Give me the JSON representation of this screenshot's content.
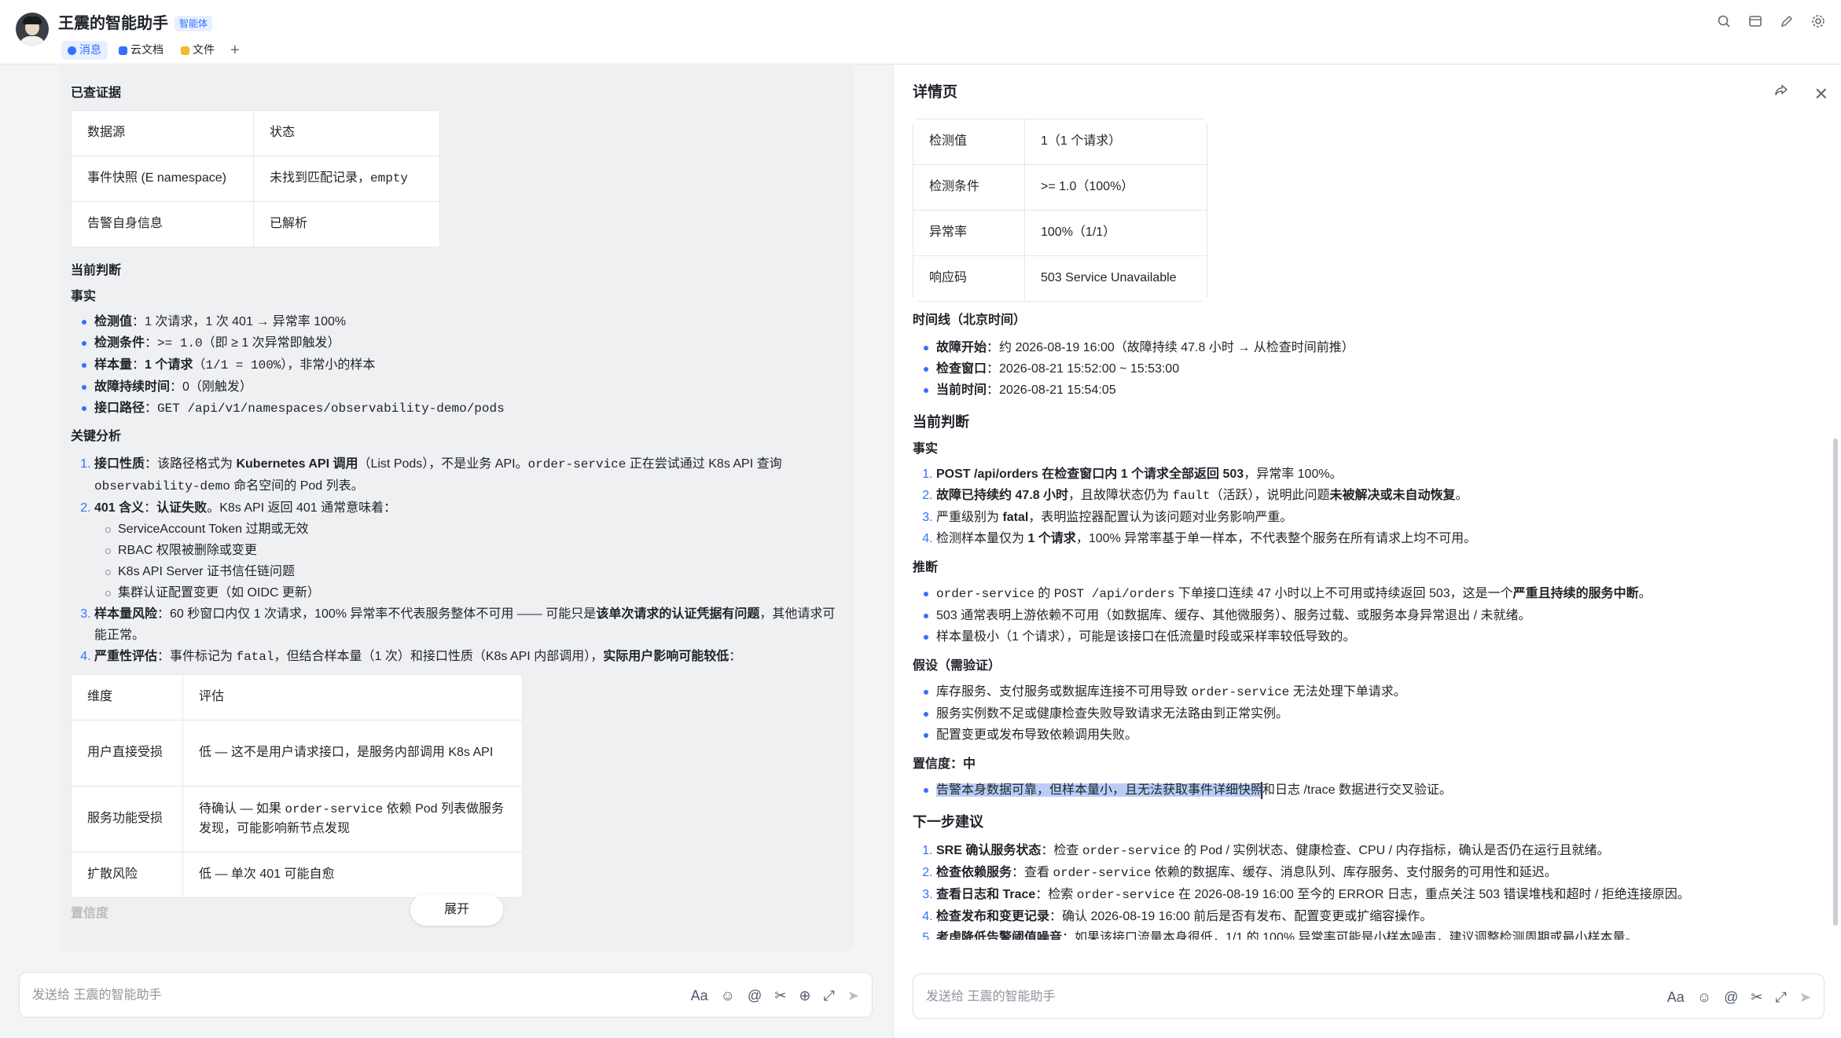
{
  "header": {
    "title": "王震的智能助手",
    "badge": "智能体",
    "tabs": [
      {
        "label": "消息",
        "icon": "chat-icon",
        "color": "#3370ff",
        "active": true
      },
      {
        "label": "云文档",
        "icon": "doc-icon",
        "color": "#3370ff",
        "active": false
      },
      {
        "label": "文件",
        "icon": "folder-icon",
        "color": "#f5b82e",
        "active": false
      }
    ],
    "add_tab": "+",
    "actions": [
      "search-icon",
      "window-icon",
      "edit-icon",
      "settings-icon"
    ]
  },
  "left": {
    "evidence_title": "已查证据",
    "evidence_table": {
      "headers": [
        "数据源",
        "状态"
      ],
      "rows": [
        [
          "事件快照 (E namespace)",
          "未找到匹配记录，",
          "empty"
        ],
        [
          "告警自身信息",
          "已解析"
        ]
      ]
    },
    "judgement_title": "当前判断",
    "facts_title": "事实",
    "facts": [
      {
        "label": "检测值",
        "text": "：1 次请求，1 次 401 → 异常率 100%"
      },
      {
        "label": "检测条件",
        "pre": "：",
        "code": ">= 1.0",
        "text": "（即 ≥ 1 次异常即触发）"
      },
      {
        "label": "样本量",
        "pre": "：",
        "bold": "1 个请求",
        "code": "（1/1 = 100%）",
        "text": "，非常小的样本"
      },
      {
        "label": "故障持续时间",
        "text": "：0（刚触发）"
      },
      {
        "label": "接口路径",
        "pre": "：",
        "code": "GET /api/v1/namespaces/observability-demo/pods"
      }
    ],
    "analysis_title": "关键分析",
    "analysis": [
      {
        "label": "接口性质",
        "t1": "：该路径格式为 ",
        "b1": "Kubernetes API 调用",
        "t2": "（List Pods），不是业务 API。",
        "c1": "order-service",
        "t3": " 正在尝试通过 K8s API 查询 ",
        "c2": "observability-demo",
        "t4": " 命名空间的 Pod 列表。"
      },
      {
        "label": "401 含义",
        "t1": "：",
        "b1": "认证失败",
        "t2": "。K8s API 返回 401 通常意味着：",
        "subs": [
          "ServiceAccount Token 过期或无效",
          "RBAC 权限被删除或变更",
          "K8s API Server 证书信任链问题",
          "集群认证配置变更（如 OIDC 更新）"
        ]
      },
      {
        "label": "样本量风险",
        "t1": "：60 秒窗口内仅 1 次请求，100% 异常率不代表服务整体不可用 —— 可能只是",
        "b1": "该单次请求的认证凭据有问题",
        "t2": "，其他请求可能正常。"
      },
      {
        "label": "严重性评估",
        "t1": "：事件标记为 ",
        "c1": "fatal",
        "t2": "，但结合样本量（1 次）和接口性质（K8s API 内部调用），",
        "b1": "实际用户影响可能较低",
        "t3": "："
      }
    ],
    "impact_table": {
      "headers": [
        "维度",
        "评估"
      ],
      "rows": [
        {
          "k": "用户直接受损",
          "v": "低 — 这不是用户请求接口，是服务内部调用 K8s API"
        },
        {
          "k": "服务功能受损",
          "v1": "待确认 — 如果 ",
          "c": "order-service",
          "v2": " 依赖 Pod 列表做服务发现，可能影响新节点发现"
        },
        {
          "k": "扩散风险",
          "v": "低 — 单次 401 可能自愈"
        }
      ]
    },
    "faded_confidence": "置信度",
    "expand_label": "展开",
    "composer_placeholder": "发送给 王震的智能助手"
  },
  "detail": {
    "title": "详情页",
    "metric_table": [
      {
        "k": "检测值",
        "v": "1（1 个请求）"
      },
      {
        "k": "检测条件",
        "v": ">= 1.0（100%）"
      },
      {
        "k": "异常率",
        "v": "100%（1/1）"
      },
      {
        "k": "响应码",
        "v": "503 Service Unavailable"
      }
    ],
    "timeline_title": "时间线（北京时间）",
    "timeline": [
      {
        "label": "故障开始",
        "text": "：约 2026-08-19 16:00（故障持续 47.8 小时 → 从检查时间前推）"
      },
      {
        "label": "检查窗口",
        "text": "：2026-08-21 15:52:00 ~ 15:53:00"
      },
      {
        "label": "当前时间",
        "text": "：2026-08-21 15:54:05"
      }
    ],
    "judgement_title": "当前判断",
    "facts_title": "事实",
    "facts": [
      {
        "b1": "POST /api/orders 在检查窗口内 1 个请求全部返回 503",
        "t1": "，异常率 100%。"
      },
      {
        "b1": "故障已持续约 47.8 小时",
        "t1": "，且故障状态仍为 ",
        "c1": "fault",
        "t2": "（活跃），说明此问题",
        "b2": "未被解决或未自动恢复",
        "t3": "。"
      },
      {
        "t0": "严重级别为 ",
        "b1": "fatal",
        "t1": "，表明监控器配置认为该问题对业务影响严重。"
      },
      {
        "t0": "检测样本量仅为 ",
        "b1": "1 个请求",
        "t1": "，100% 异常率基于单一样本，不代表整个服务在所有请求上均不可用。"
      }
    ],
    "inference_title": "推断",
    "inference": [
      {
        "c1": "order-service",
        "t1": " 的 ",
        "c2": "POST /api/orders",
        "t2": " 下单接口连续 47 小时以上不可用或持续返回 503，这是一个",
        "b1": "严重且持续的服务中断",
        "t3": "。"
      },
      {
        "t1": "503 通常表明上游依赖不可用（如数据库、缓存、其他微服务）、服务过载、或服务本身异常退出 / 未就绪。"
      },
      {
        "t1": "样本量极小（1 个请求），可能是该接口在低流量时段或采样率较低导致的。"
      }
    ],
    "hypothesis_title": "假设（需验证）",
    "hypothesis": [
      {
        "t1": "库存服务、支付服务或数据库连接不可用导致 ",
        "c1": "order-service",
        "t2": " 无法处理下单请求。"
      },
      {
        "t1": "服务实例数不足或健康检查失败导致请求无法路由到正常实例。"
      },
      {
        "t1": "配置变更或发布导致依赖调用失败。"
      }
    ],
    "confidence_title": "置信度：中",
    "confidence_highlight": "告警本身数据可靠，但样本量小，且无法获取事件详细快照",
    "confidence_rest": "和日志 /trace 数据进行交叉验证。",
    "next_title": "下一步建议",
    "next": [
      {
        "b1": "SRE 确认服务状态",
        "t1": "：检查 ",
        "c1": "order-service",
        "t2": " 的 Pod / 实例状态、健康检查、CPU / 内存指标，确认是否仍在运行且就绪。"
      },
      {
        "b1": "检查依赖服务",
        "t1": "：查看 ",
        "c1": "order-service",
        "t2": " 依赖的数据库、缓存、消息队列、库存服务、支付服务的可用性和延迟。"
      },
      {
        "b1": "查看日志和 Trace",
        "t1": "：检索 ",
        "c1": "order-service",
        "t2": " 在 2026-08-19 16:00 至今的 ERROR 日志，重点关注 503 错误堆栈和超时 / 拒绝连接原因。"
      },
      {
        "b1": "检查发布和变更记录",
        "t1": "：确认 2026-08-19 16:00 前后是否有发布、配置变更或扩缩容操作。"
      },
      {
        "b1": "考虑降低告警阈值噪音",
        "t1": "：如果该接口流量本身很低，1/1 的 100% 异常率可能是小样本噪声，建议调整检测周期或最小样本量。"
      }
    ],
    "composer_placeholder": "发送给 王震的智能助手"
  }
}
